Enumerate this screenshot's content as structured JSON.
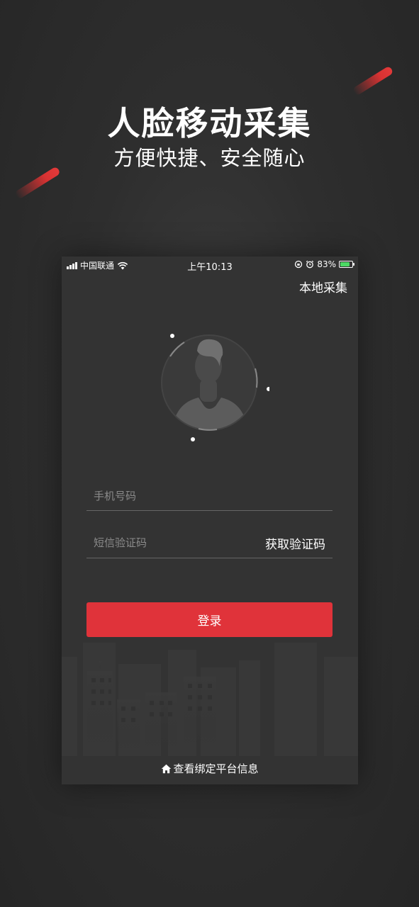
{
  "promo": {
    "title": "人脸移动采集",
    "subtitle": "方便快捷、安全随心"
  },
  "status_bar": {
    "carrier": "中国联通",
    "time": "上午10:13",
    "battery_percent": "83%",
    "battery_level": 0.83,
    "icons": [
      "signal-icon",
      "wifi-icon",
      "orientation-lock-icon",
      "alarm-icon",
      "battery-icon"
    ]
  },
  "header": {
    "local_collect_label": "本地采集"
  },
  "form": {
    "phone_placeholder": "手机号码",
    "phone_value": "",
    "code_placeholder": "短信验证码",
    "code_value": "",
    "get_code_label": "获取验证码",
    "login_label": "登录"
  },
  "footer": {
    "bind_info_label": "查看绑定平台信息",
    "icon": "home-icon"
  },
  "colors": {
    "accent": "#e0333a",
    "background": "#2e2e2e",
    "screen": "#333333",
    "battery_green": "#4cd964"
  }
}
